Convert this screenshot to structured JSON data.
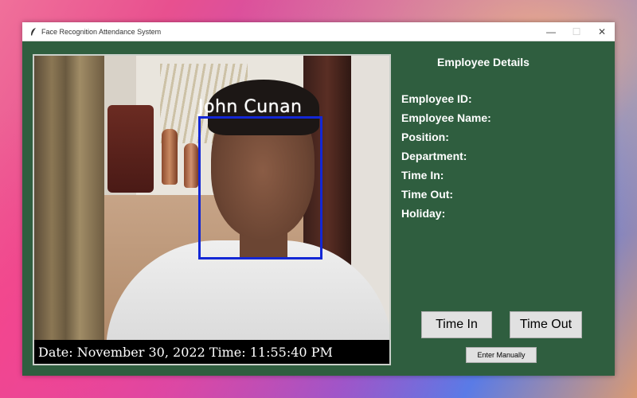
{
  "window": {
    "title": "Face Recognition Attendance System",
    "controls": {
      "minimize": "—",
      "maximize": "☐",
      "close": "✕"
    },
    "icons": {
      "app": "feather-icon"
    }
  },
  "camera": {
    "recognized_name": "John Cunan",
    "datetime_overlay": "Date: November 30, 2022  Time: 11:55:40 PM",
    "box_color": "#1327d6"
  },
  "details": {
    "title": "Employee Details",
    "fields": [
      {
        "label": "Employee ID:"
      },
      {
        "label": "Employee Name:"
      },
      {
        "label": "Position:"
      },
      {
        "label": "Department:"
      },
      {
        "label": "Time In:"
      },
      {
        "label": "Time Out:"
      },
      {
        "label": "Holiday:"
      }
    ]
  },
  "buttons": {
    "time_in": "Time In",
    "time_out": "Time Out",
    "enter_manually": "Enter Manually"
  },
  "colors": {
    "panel_bg": "#2f5e3f",
    "text": "#ffffff"
  }
}
